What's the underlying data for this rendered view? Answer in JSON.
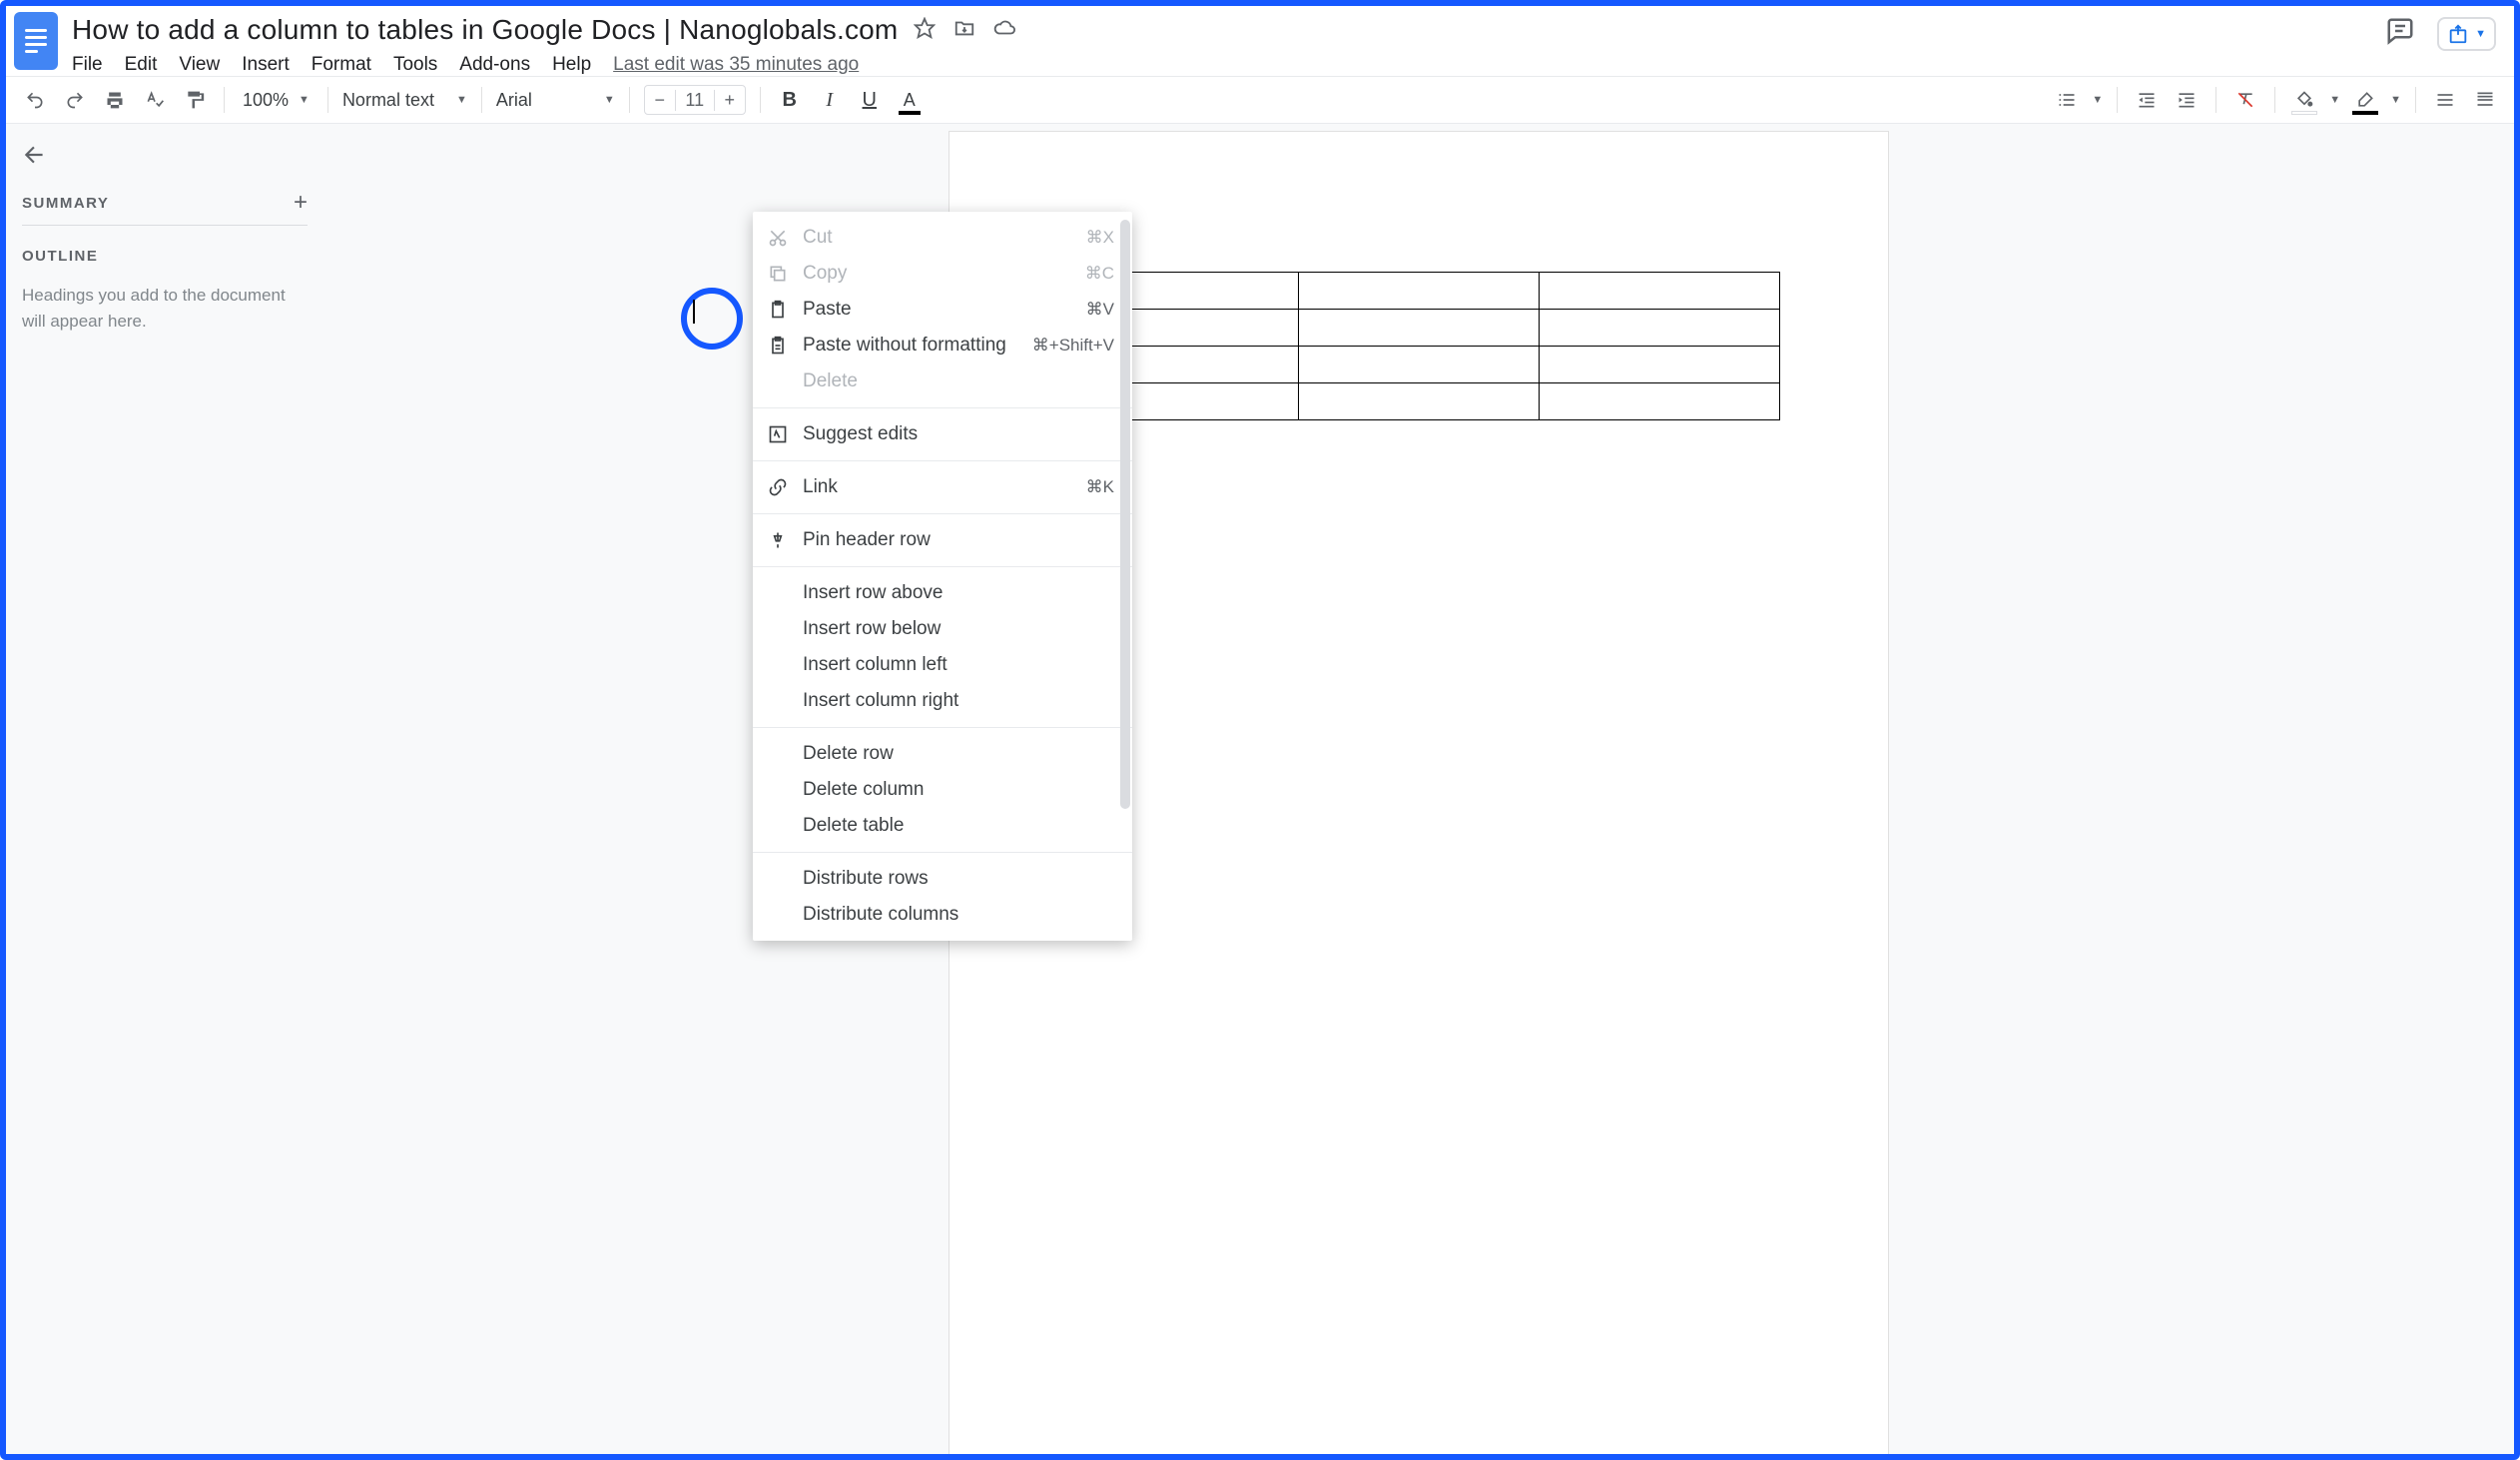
{
  "doc_title": "How to add a column to tables in Google Docs | Nanoglobals.com",
  "menubar": {
    "file": "File",
    "edit": "Edit",
    "view": "View",
    "insert": "Insert",
    "format": "Format",
    "tools": "Tools",
    "addons": "Add-ons",
    "help": "Help",
    "last_edit": "Last edit was 35 minutes ago"
  },
  "toolbar": {
    "zoom": "100%",
    "styles": "Normal text",
    "font": "Arial",
    "font_size": "11"
  },
  "outline": {
    "summary": "SUMMARY",
    "outline_label": "OUTLINE",
    "hint": "Headings you add to the document will appear here."
  },
  "context_menu": {
    "cut": {
      "label": "Cut",
      "shortcut": "⌘X"
    },
    "copy": {
      "label": "Copy",
      "shortcut": "⌘C"
    },
    "paste": {
      "label": "Paste",
      "shortcut": "⌘V"
    },
    "paste_no_fmt": {
      "label": "Paste without formatting",
      "shortcut": "⌘+Shift+V"
    },
    "delete": {
      "label": "Delete"
    },
    "suggest": {
      "label": "Suggest edits"
    },
    "link": {
      "label": "Link",
      "shortcut": "⌘K"
    },
    "pin_header": {
      "label": "Pin header row"
    },
    "insert_row_above": {
      "label": "Insert row above"
    },
    "insert_row_below": {
      "label": "Insert row below"
    },
    "insert_col_left": {
      "label": "Insert column left"
    },
    "insert_col_right": {
      "label": "Insert column right"
    },
    "delete_row": {
      "label": "Delete row"
    },
    "delete_col": {
      "label": "Delete column"
    },
    "delete_table": {
      "label": "Delete table"
    },
    "dist_rows": {
      "label": "Distribute rows"
    },
    "dist_cols": {
      "label": "Distribute columns"
    }
  },
  "table": {
    "rows": 4,
    "cols": 3
  }
}
